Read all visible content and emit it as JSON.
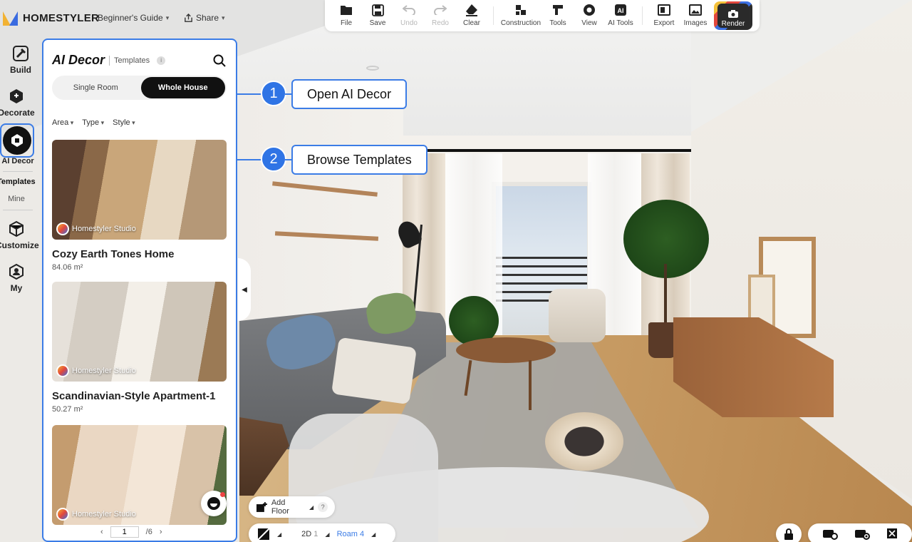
{
  "app": {
    "brand": "HOMESTYLER",
    "beginners_guide": "Beginner's Guide",
    "share": "Share"
  },
  "toolbar": {
    "items": [
      {
        "label": "File",
        "icon": "folder-icon"
      },
      {
        "label": "Save",
        "icon": "save-icon"
      },
      {
        "label": "Undo",
        "icon": "undo-icon",
        "disabled": true
      },
      {
        "label": "Redo",
        "icon": "redo-icon",
        "disabled": true
      },
      {
        "label": "Clear",
        "icon": "eraser-icon"
      },
      {
        "label": "Construction",
        "icon": "construction-icon"
      },
      {
        "label": "Tools",
        "icon": "tools-icon"
      },
      {
        "label": "View",
        "icon": "eye-icon"
      },
      {
        "label": "AI Tools",
        "icon": "ai-icon"
      },
      {
        "label": "Export",
        "icon": "export-icon"
      },
      {
        "label": "Images",
        "icon": "image-icon"
      }
    ],
    "render": "Render"
  },
  "rail": {
    "build": "Build",
    "decorate": "Decorate",
    "ai_decor": "AI Decor",
    "templates": "Templates",
    "mine": "Mine",
    "customize": "Customize",
    "my": "My"
  },
  "panel": {
    "title": "AI Decor",
    "subtitle": "Templates",
    "info": "i",
    "segments": {
      "single": "Single Room",
      "whole": "Whole House",
      "active": "Whole House"
    },
    "filters": [
      "Area",
      "Type",
      "Style"
    ],
    "cards": [
      {
        "title": "Cozy Earth Tones Home",
        "size": "84.06 m²",
        "source": "Homestyler Studio"
      },
      {
        "title": "Scandinavian-Style Apartment-1",
        "size": "50.27 m²",
        "source": "Homestyler Studio"
      },
      {
        "title": "",
        "size": "",
        "source": "Homestyler Studio"
      }
    ],
    "pager": {
      "page": "1",
      "total": "/6"
    }
  },
  "callouts": [
    {
      "num": "1",
      "text": "Open AI Decor"
    },
    {
      "num": "2",
      "text": "Browse Templates"
    }
  ],
  "bottom": {
    "add_floor": "Add Floor",
    "help": "?",
    "view_2d": "2D",
    "view_2d_num": "1",
    "room": "Roam",
    "room_num": "4"
  },
  "colors": {
    "accent": "#3b7ce6",
    "callout_fill": "#2f74e5",
    "active_segment": "#111111"
  }
}
